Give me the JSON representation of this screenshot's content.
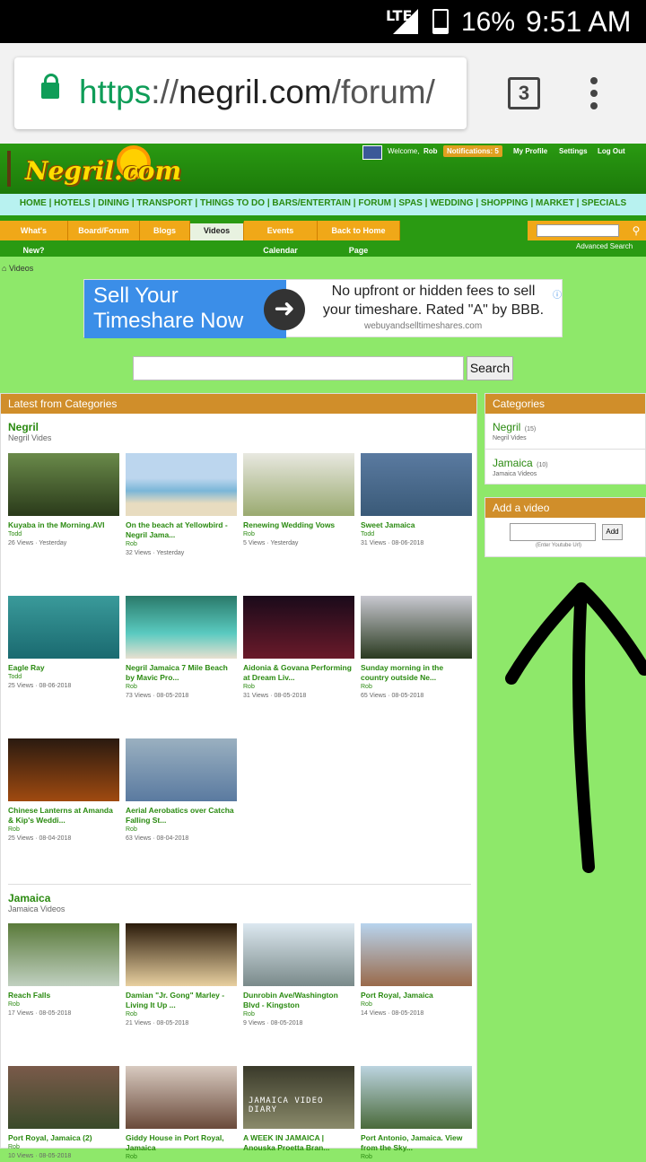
{
  "status": {
    "network": "LTE",
    "battery": "16%",
    "time": "9:51 AM"
  },
  "browser": {
    "url_scheme": "https",
    "url_sep": "://",
    "url_domain": "negril.com",
    "url_path": "/forum/",
    "tabs": "3"
  },
  "site": {
    "logo": "Negril.com",
    "welcome": "Welcome,",
    "user": "Rob",
    "notifications": "Notifications: 5",
    "my_profile": "My Profile",
    "settings": "Settings",
    "logout": "Log Out",
    "nav": "HOME | HOTELS | DINING | TRANSPORT | THINGS TO DO | BARS/ENTERTAIN | FORUM | SPAS | WEDDING | SHOPPING | MARKET | SPECIALS",
    "subtabs": [
      "What's New?",
      "Board/Forum",
      "Blogs",
      "Videos",
      "Events Calendar",
      "Back to Home Page"
    ],
    "advanced_search": "Advanced Search",
    "breadcrumb": "Videos"
  },
  "ad": {
    "headline": "Sell Your Timeshare Now",
    "arrow": "➜",
    "message": "No upfront or hidden fees to sell your timeshare. Rated \"A\" by BBB.",
    "domain": "webuyandselltimeshares.com",
    "info": "ⓘ"
  },
  "search": {
    "button": "Search"
  },
  "main": {
    "heading": "Latest from Categories",
    "categories": [
      {
        "name": "Negril",
        "sub": "Negril Vides",
        "videos": [
          {
            "title": "Kuyaba in the Morning.AVI",
            "author": "Todd",
            "meta": "26 Views · Yesterday"
          },
          {
            "title": "On the beach at Yellowbird - Negril Jama...",
            "author": "Rob",
            "meta": "32 Views · Yesterday"
          },
          {
            "title": "Renewing Wedding Vows",
            "author": "Rob",
            "meta": "5 Views · Yesterday"
          },
          {
            "title": "Sweet Jamaica",
            "author": "Todd",
            "meta": "31 Views · 08-06-2018"
          },
          {
            "title": "Eagle Ray",
            "author": "Todd",
            "meta": "25 Views · 08-06-2018"
          },
          {
            "title": "Negril Jamaica 7 Mile Beach by Mavic Pro...",
            "author": "Rob",
            "meta": "73 Views · 08-05-2018"
          },
          {
            "title": "Aidonia & Govana Performing at Dream Liv...",
            "author": "Rob",
            "meta": "31 Views · 08-05-2018"
          },
          {
            "title": "Sunday morning in the country outside Ne...",
            "author": "Rob",
            "meta": "65 Views · 08-05-2018"
          },
          {
            "title": "Chinese Lanterns at Amanda & Kip's Weddi...",
            "author": "Rob",
            "meta": "25 Views · 08-04-2018"
          },
          {
            "title": "Aerial Aerobatics over Catcha Falling St...",
            "author": "Rob",
            "meta": "63 Views · 08-04-2018"
          }
        ]
      },
      {
        "name": "Jamaica",
        "sub": "Jamaica Videos",
        "videos": [
          {
            "title": "Reach Falls",
            "author": "Rob",
            "meta": "17 Views · 08-05-2018"
          },
          {
            "title": "Damian \"Jr. Gong\" Marley - Living It Up ...",
            "author": "Rob",
            "meta": "21 Views · 08-05-2018"
          },
          {
            "title": "Dunrobin Ave/Washington Blvd - Kingston",
            "author": "Rob",
            "meta": "9 Views · 08-05-2018"
          },
          {
            "title": "Port Royal, Jamaica",
            "author": "Rob",
            "meta": "14 Views · 08-05-2018"
          },
          {
            "title": "Port Royal, Jamaica (2)",
            "author": "Rob",
            "meta": "10 Views · 08-05-2018"
          },
          {
            "title": "Giddy House in Port Royal, Jamaica",
            "author": "Rob",
            "meta": ""
          },
          {
            "title": "A WEEK IN JAMAICA | Anouska Proetta Bran...",
            "author": "",
            "meta": ""
          },
          {
            "title": "Port Antonio, Jamaica. View from the Sky...",
            "author": "Rob",
            "meta": ""
          }
        ]
      }
    ]
  },
  "sidebar": {
    "categories_heading": "Categories",
    "categories": [
      {
        "name": "Negril",
        "count": "(15)",
        "desc": "Negril Vides"
      },
      {
        "name": "Jamaica",
        "count": "(10)",
        "desc": "Jamaica Videos"
      }
    ],
    "add_heading": "Add a video",
    "add_button": "Add",
    "add_hint": "(Enter Youtube Url)"
  },
  "thumb_overlay": "JAMAICA VIDEO DIARY"
}
